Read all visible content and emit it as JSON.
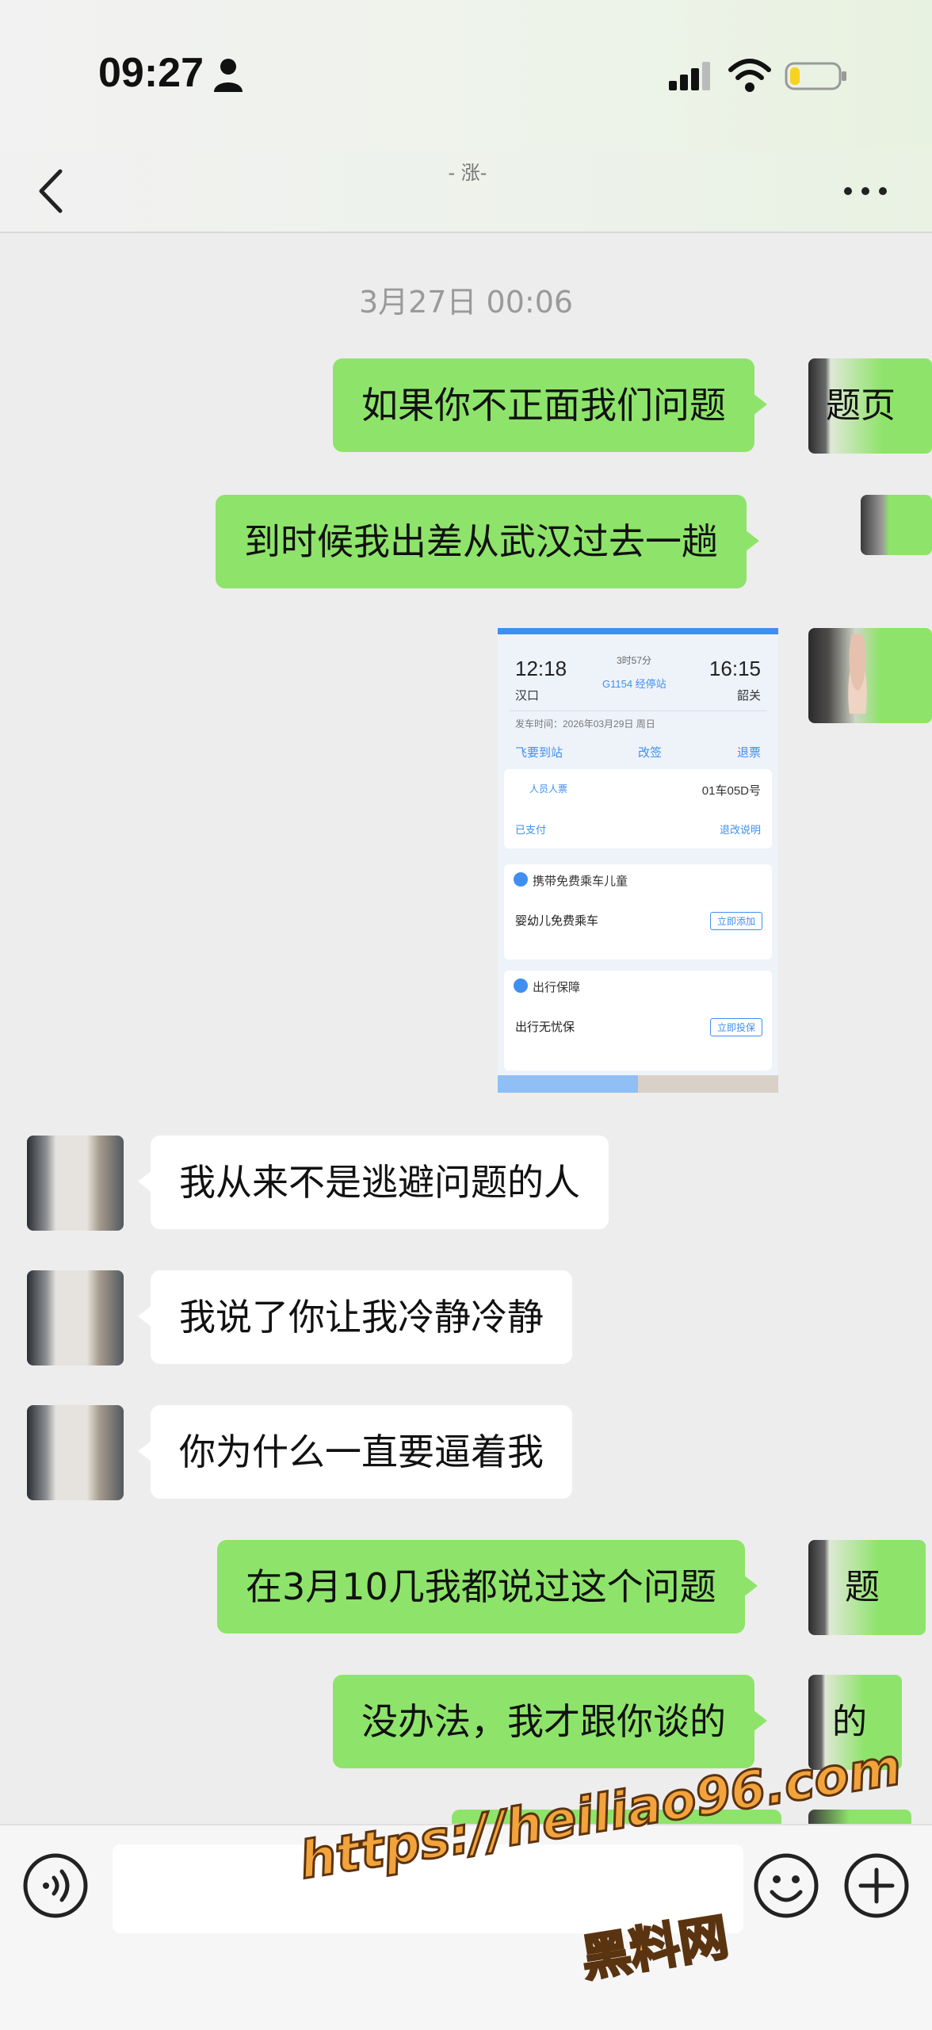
{
  "status_bar": {
    "time": "09:27",
    "icons": [
      "person-icon",
      "signal-icon",
      "wifi-icon",
      "battery-icon"
    ],
    "battery_level": 0.2
  },
  "nav": {
    "title": "- 涨-",
    "back_icon": "chevron-left-icon",
    "more_icon": "more-dots-icon"
  },
  "chat": {
    "timestamp": "3月27日 00:06",
    "messages": [
      {
        "from": "me",
        "text": "如果你不正面我们问题",
        "avatar_fragment": "题页"
      },
      {
        "from": "me",
        "text": "到时候我出差从武汉过去一趟"
      },
      {
        "from": "me",
        "type": "image"
      },
      {
        "from": "them",
        "text": "我从来不是逃避问题的人"
      },
      {
        "from": "them",
        "text": "我说了你让我冷静冷静"
      },
      {
        "from": "them",
        "text": "你为什么一直要逼着我"
      },
      {
        "from": "me",
        "text": "在3月10几我都说过这个问题",
        "avatar_fragment": "题"
      },
      {
        "from": "me",
        "text": "没办法，我才跟你谈的",
        "avatar_fragment": "的"
      }
    ]
  },
  "ticket_screenshot": {
    "departure_time": "12:18",
    "arrival_time": "16:15",
    "duration": "3时57分",
    "train": "G1154 经停站",
    "from_station": "汉口",
    "to_station": "韶关",
    "depart_line": "发车时间：2026年03月29日 周日",
    "actions": [
      "飞要到站",
      "改签",
      "退票"
    ],
    "passenger": "人员人票",
    "seat": "01车05D号",
    "paid": "已支付",
    "refund_rules": "退改说明",
    "section_child": "携带免费乘车儿童",
    "child_item": "婴幼儿免费乘车",
    "child_button": "立即添加",
    "section_insurance": "出行保障",
    "insurance_item": "出行无忧保",
    "insurance_button": "立即投保"
  },
  "input_bar": {
    "voice_icon": "voice-icon",
    "emoji_icon": "emoji-icon",
    "plus_icon": "plus-icon",
    "input_value": ""
  },
  "watermark": {
    "url": "https://heiliao96.com",
    "name": "黑料网"
  },
  "colors": {
    "my_bubble": "#8ee46a",
    "their_bubble": "#ffffff",
    "background": "#ededed",
    "watermark": "#f3a33b"
  }
}
